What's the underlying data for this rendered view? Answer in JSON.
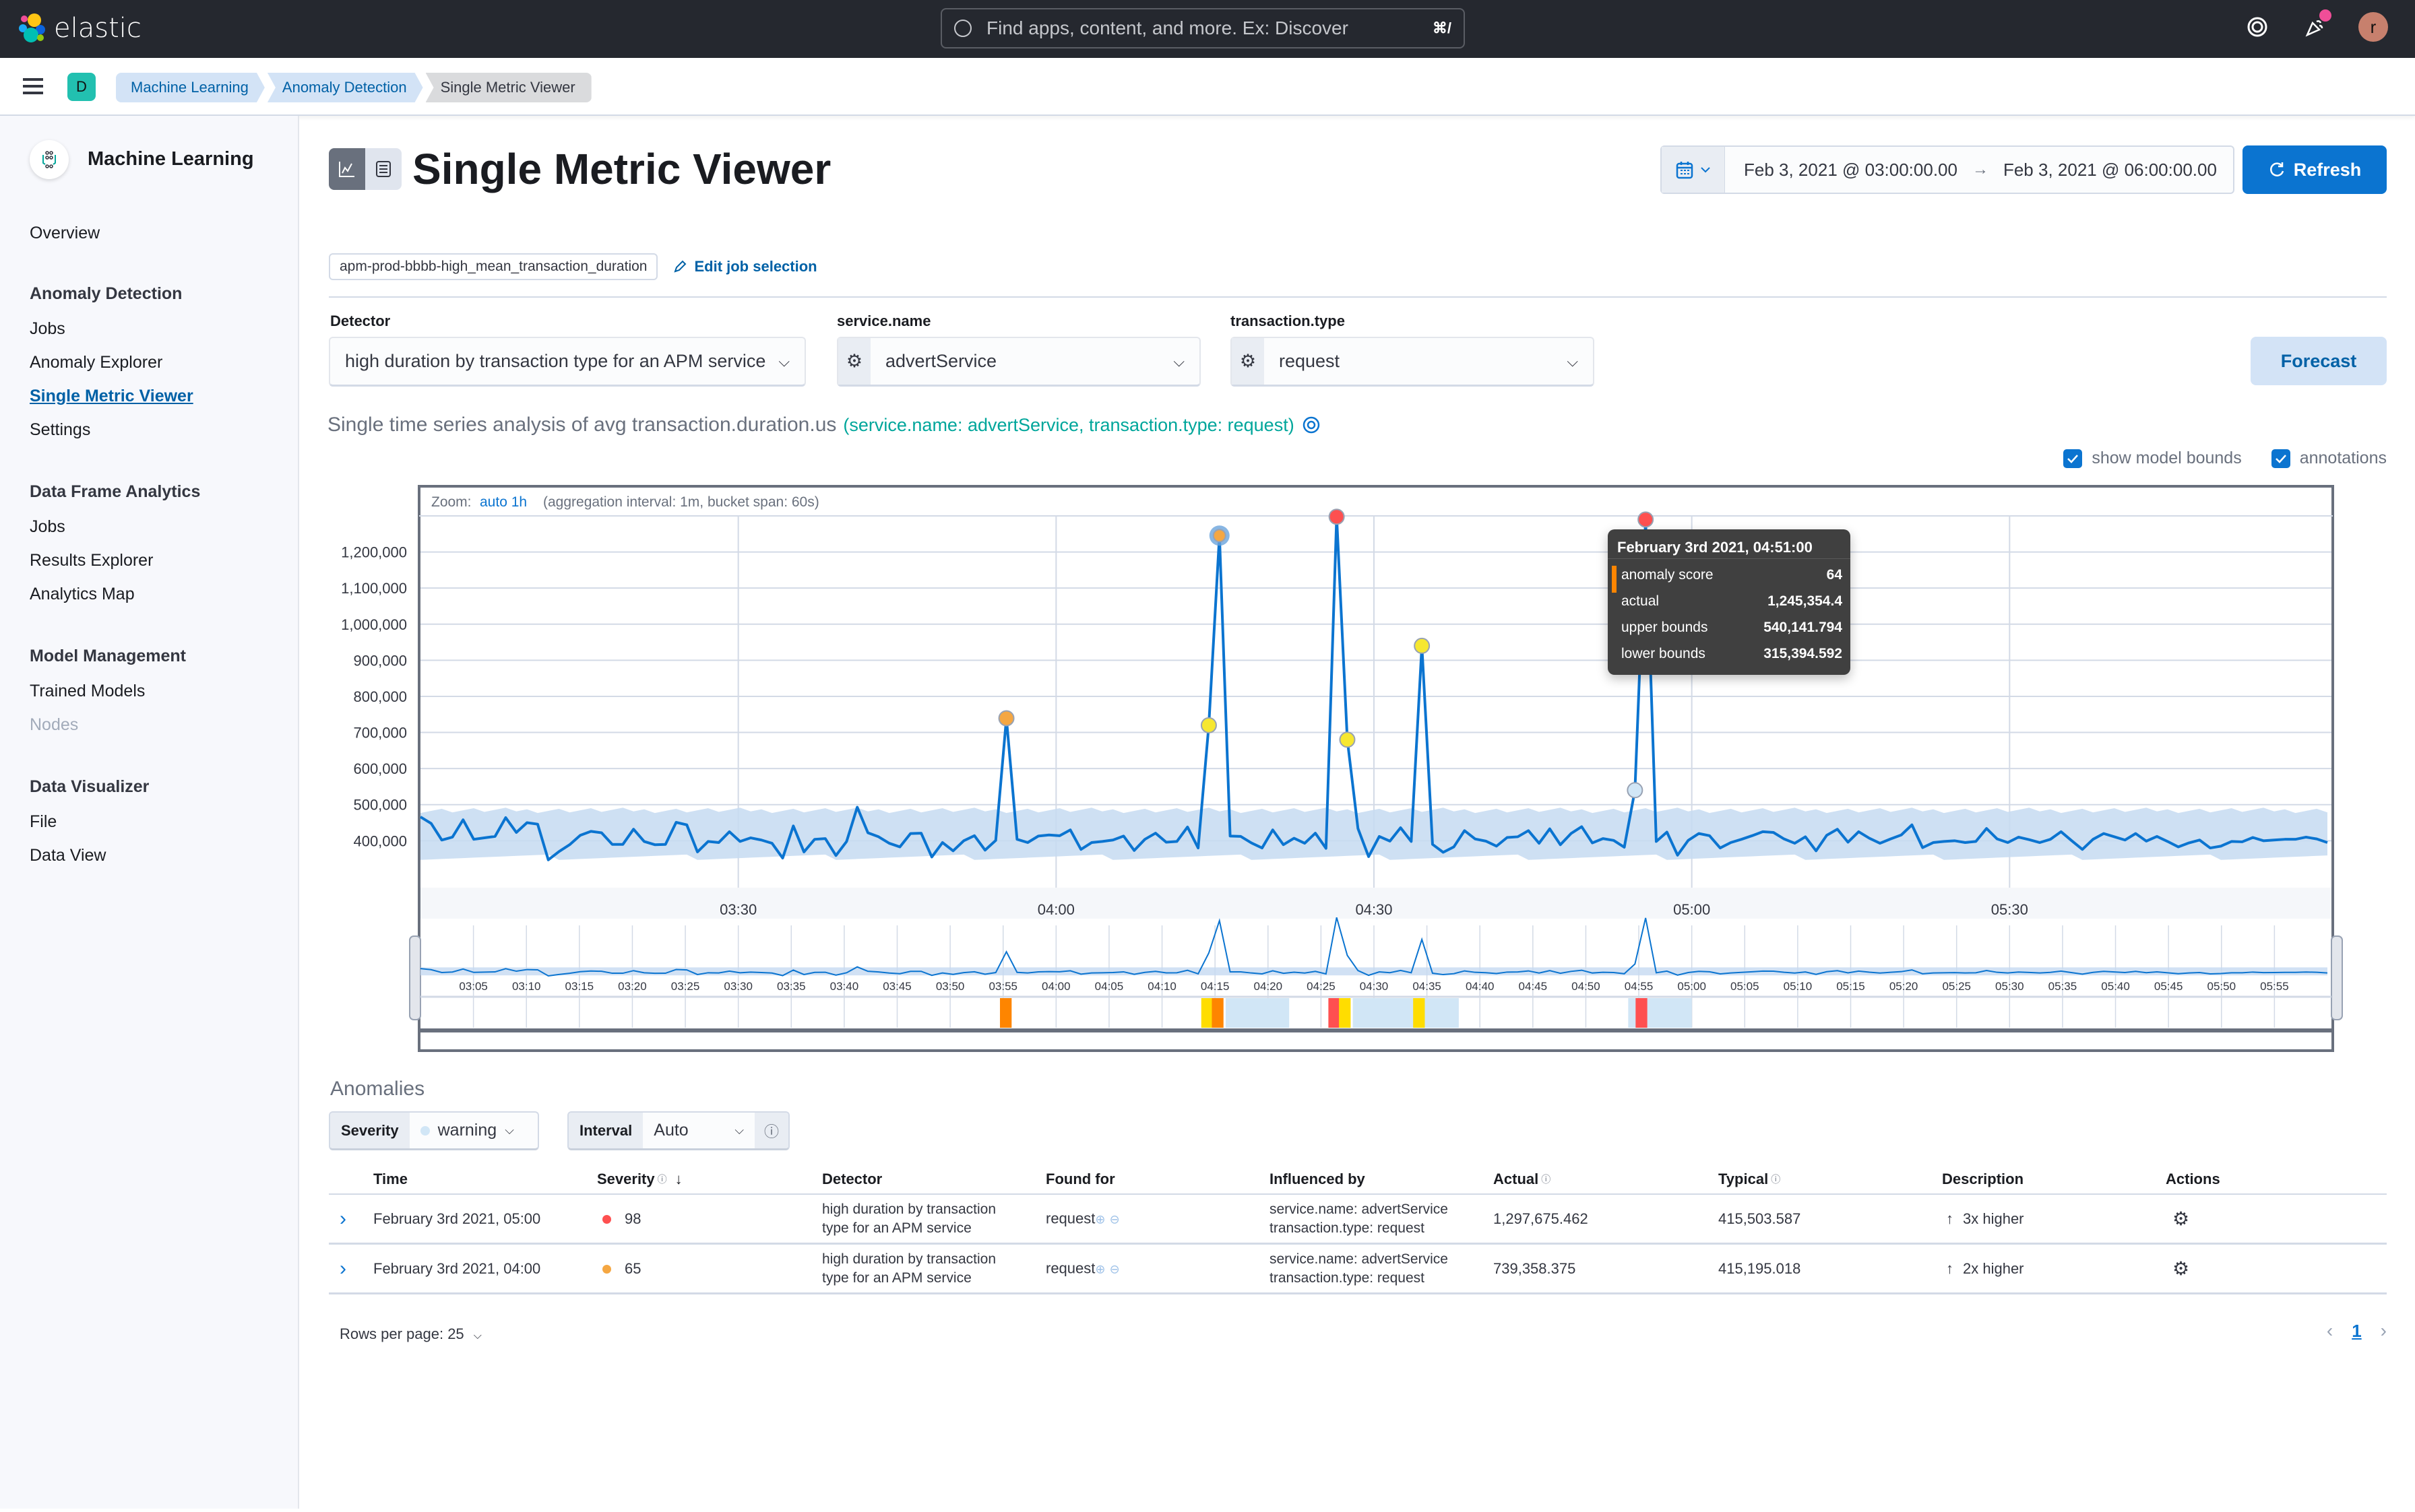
{
  "header": {
    "brand": "elastic",
    "search_placeholder": "Find apps, content, and more. Ex: Discover",
    "search_shortcut": "⌘/",
    "avatar_initial": "r",
    "icons": [
      "help-icon",
      "newsfeed-icon",
      "user-avatar"
    ]
  },
  "breadcrumbs": {
    "space_initial": "D",
    "items": [
      "Machine Learning",
      "Anomaly Detection",
      "Single Metric Viewer"
    ]
  },
  "sidebar": {
    "title": "Machine Learning",
    "overview": "Overview",
    "sections": [
      {
        "heading": "Anomaly Detection",
        "items": [
          "Jobs",
          "Anomaly Explorer",
          "Single Metric Viewer",
          "Settings"
        ]
      },
      {
        "heading": "Data Frame Analytics",
        "items": [
          "Jobs",
          "Results Explorer",
          "Analytics Map"
        ]
      },
      {
        "heading": "Model Management",
        "items": [
          "Trained Models",
          "Nodes"
        ]
      },
      {
        "heading": "Data Visualizer",
        "items": [
          "File",
          "Data View"
        ]
      }
    ],
    "active_item": "Single Metric Viewer",
    "disabled_item": "Nodes"
  },
  "page": {
    "title": "Single Metric Viewer",
    "date_start": "Feb 3, 2021 @ 03:00:00.00",
    "date_arrow": "→",
    "date_end": "Feb 3, 2021 @ 06:00:00.00",
    "refresh_label": "Refresh",
    "job_id": "apm-prod-bbbb-high_mean_transaction_duration",
    "edit_job_label": "Edit job selection",
    "forecast_label": "Forecast"
  },
  "filters": {
    "detector_label": "Detector",
    "detector_value": "high duration by transaction type for an APM service",
    "service_label": "service.name",
    "service_value": "advertService",
    "txtype_label": "transaction.type",
    "txtype_value": "request"
  },
  "analysis": {
    "title": "Single time series analysis of avg transaction.duration.us",
    "entities": "(service.name: advertService, transaction.type: request)",
    "show_model_bounds_label": "show model bounds",
    "show_model_bounds": true,
    "annotations_label": "annotations",
    "annotations": true
  },
  "chart_data": {
    "type": "line",
    "title": "Zoom: auto 1h (aggregation interval: 1m, bucket span: 60s)",
    "zoom_label": "Zoom:",
    "zoom_value": "auto 1h",
    "zoom_info": "(aggregation interval: 1m, bucket span: 60s)",
    "xlabel": "",
    "ylabel": "",
    "x_range_minutes": [
      0,
      180
    ],
    "x_start": "03:00",
    "x_ticks": [
      "03:30",
      "04:00",
      "04:30",
      "05:00",
      "05:30"
    ],
    "ylim": [
      270000,
      1300000
    ],
    "y_ticks": [
      "400,000",
      "500,000",
      "600,000",
      "700,000",
      "800,000",
      "900,000",
      "1,000,000",
      "1,100,000",
      "1,200,000"
    ],
    "y_tick_values": [
      400000,
      500000,
      600000,
      700000,
      800000,
      900000,
      1000000,
      1100000,
      1200000
    ],
    "grid": true,
    "baseline": [
      466,
      448,
      402,
      410,
      458,
      404,
      408,
      412,
      464,
      423,
      450,
      446,
      347,
      370,
      389,
      415,
      426,
      422,
      390,
      390,
      432,
      398,
      389,
      390,
      451,
      444,
      369,
      398,
      395,
      425,
      398,
      408,
      402,
      393,
      352,
      441,
      369,
      404,
      406,
      359,
      398,
      493,
      422,
      411,
      393,
      383,
      420,
      421,
      355,
      395,
      372,
      400,
      414,
      374,
      401,
      416,
      404,
      395,
      413,
      416,
      414,
      430,
      376,
      395,
      398,
      402,
      413,
      373,
      404,
      421,
      396,
      398,
      438,
      380,
      388,
      396,
      413,
      412,
      394,
      380,
      430,
      389,
      407,
      393,
      421,
      379,
      404,
      398,
      434,
      356,
      412,
      399,
      436,
      398,
      404,
      390,
      368,
      383,
      428,
      405,
      399,
      385,
      409,
      411,
      428,
      393,
      433,
      389,
      420,
      439,
      394,
      406,
      401,
      382,
      413,
      408,
      398,
      424,
      360,
      401,
      420,
      414,
      380,
      395,
      404,
      414,
      425,
      423,
      405,
      393,
      411,
      372,
      415,
      432,
      396,
      425,
      407,
      393,
      405,
      416,
      444,
      381,
      395,
      398,
      400,
      395,
      398,
      434,
      405,
      395,
      410,
      403,
      395,
      404,
      425,
      400,
      376,
      404,
      420,
      411,
      402,
      420,
      399,
      412,
      398,
      383,
      394,
      402,
      380,
      385,
      398,
      397,
      409,
      400,
      402,
      404,
      404,
      410,
      405,
      395
    ],
    "model_upper": 485000,
    "model_lower": 355000,
    "spikes": [
      {
        "minute": 55,
        "value": 739358,
        "score": 65,
        "color": "#f5a742"
      },
      {
        "minute": 74,
        "value": 720000,
        "score": 30,
        "color": "#f6e730"
      },
      {
        "minute": 75,
        "value": 1245354,
        "score": 64,
        "color": "#f5a742",
        "selected": true
      },
      {
        "minute": 86,
        "value": 1297675,
        "score": 98,
        "color": "#fe5050"
      },
      {
        "minute": 87,
        "value": 680000,
        "score": 30,
        "color": "#f6e730"
      },
      {
        "minute": 94,
        "value": 940000,
        "score": 35,
        "color": "#f6e730"
      },
      {
        "minute": 114,
        "value": 540000,
        "score": 10,
        "color": "#d1e6f6"
      },
      {
        "minute": 115,
        "value": 1290000,
        "score": 95,
        "color": "#fe5050"
      }
    ],
    "context_ticks": [
      "03:05",
      "03:10",
      "03:15",
      "03:20",
      "03:25",
      "03:30",
      "03:35",
      "03:40",
      "03:45",
      "03:50",
      "03:55",
      "04:00",
      "04:05",
      "04:10",
      "04:15",
      "04:20",
      "04:25",
      "04:30",
      "04:35",
      "04:40",
      "04:45",
      "04:50",
      "04:55",
      "05:00",
      "05:05",
      "05:10",
      "05:15",
      "05:20",
      "05:25",
      "05:30",
      "05:35",
      "05:40",
      "05:45",
      "05:50",
      "05:55"
    ],
    "swimlane": [
      {
        "minute": 55,
        "color": "#fe8500"
      },
      {
        "minute": 74,
        "color": "#ffdd00"
      },
      {
        "minute": 75,
        "color": "#fe8500"
      },
      {
        "minute": 86,
        "color": "#fe5050"
      },
      {
        "minute": 87,
        "color": "#ffdd00"
      },
      {
        "minute": 94,
        "color": "#ffdd00"
      },
      {
        "minute": 115,
        "color": "#fe5050"
      }
    ],
    "swimlane_low_ranges": [
      [
        76,
        82
      ],
      [
        88,
        98
      ],
      [
        93,
        98
      ],
      [
        114,
        120
      ]
    ]
  },
  "tooltip": {
    "time": "February 3rd 2021, 04:51:00",
    "rows": [
      {
        "label": "anomaly score",
        "value": "64"
      },
      {
        "label": "actual",
        "value": "1,245,354.4"
      },
      {
        "label": "upper bounds",
        "value": "540,141.794"
      },
      {
        "label": "lower bounds",
        "value": "315,394.592"
      }
    ],
    "score_color": "#fe8500"
  },
  "anomalies": {
    "title": "Anomalies",
    "severity_label": "Severity",
    "severity_value": "warning",
    "interval_label": "Interval",
    "interval_value": "Auto",
    "columns": [
      "Time",
      "Severity",
      "Detector",
      "Found for",
      "Influenced by",
      "Actual",
      "Typical",
      "Description",
      "Actions"
    ],
    "rows": [
      {
        "time": "February 3rd 2021, 05:00",
        "severity": "98",
        "severity_color": "#fe5050",
        "detector_l1": "high duration by transaction",
        "detector_l2": "type for an APM service",
        "found_for": "request",
        "influenced_l1": "service.name: advertService",
        "influenced_l2": "transaction.type: request",
        "actual": "1,297,675.462",
        "typical": "415,503.587",
        "description": "3x higher"
      },
      {
        "time": "February 3rd 2021, 04:00",
        "severity": "65",
        "severity_color": "#f5a742",
        "detector_l1": "high duration by transaction",
        "detector_l2": "type for an APM service",
        "found_for": "request",
        "influenced_l1": "service.name: advertService",
        "influenced_l2": "transaction.type: request",
        "actual": "739,358.375",
        "typical": "415,195.018",
        "description": "2x higher"
      }
    ],
    "rows_per_page": "Rows per page: 25",
    "current_page": "1"
  }
}
